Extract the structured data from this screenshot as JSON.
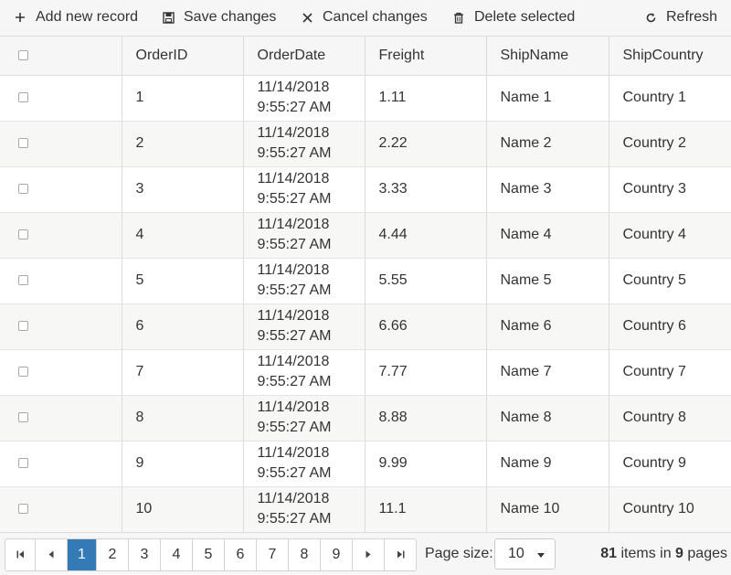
{
  "toolbar": {
    "add_label": "Add new record",
    "save_label": "Save changes",
    "cancel_label": "Cancel changes",
    "delete_label": "Delete selected",
    "refresh_label": "Refresh"
  },
  "grid": {
    "columns": [
      "OrderID",
      "OrderDate",
      "Freight",
      "ShipName",
      "ShipCountry"
    ],
    "rows": [
      {
        "id": "1",
        "date": "11/14/2018",
        "time": "9:55:27 AM",
        "freight": "1.11",
        "name": "Name 1",
        "country": "Country 1"
      },
      {
        "id": "2",
        "date": "11/14/2018",
        "time": "9:55:27 AM",
        "freight": "2.22",
        "name": "Name 2",
        "country": "Country 2"
      },
      {
        "id": "3",
        "date": "11/14/2018",
        "time": "9:55:27 AM",
        "freight": "3.33",
        "name": "Name 3",
        "country": "Country 3"
      },
      {
        "id": "4",
        "date": "11/14/2018",
        "time": "9:55:27 AM",
        "freight": "4.44",
        "name": "Name 4",
        "country": "Country 4"
      },
      {
        "id": "5",
        "date": "11/14/2018",
        "time": "9:55:27 AM",
        "freight": "5.55",
        "name": "Name 5",
        "country": "Country 5"
      },
      {
        "id": "6",
        "date": "11/14/2018",
        "time": "9:55:27 AM",
        "freight": "6.66",
        "name": "Name 6",
        "country": "Country 6"
      },
      {
        "id": "7",
        "date": "11/14/2018",
        "time": "9:55:27 AM",
        "freight": "7.77",
        "name": "Name 7",
        "country": "Country 7"
      },
      {
        "id": "8",
        "date": "11/14/2018",
        "time": "9:55:27 AM",
        "freight": "8.88",
        "name": "Name 8",
        "country": "Country 8"
      },
      {
        "id": "9",
        "date": "11/14/2018",
        "time": "9:55:27 AM",
        "freight": "9.99",
        "name": "Name 9",
        "country": "Country 9"
      },
      {
        "id": "10",
        "date": "11/14/2018",
        "time": "9:55:27 AM",
        "freight": "11.1",
        "name": "Name 10",
        "country": "Country 10"
      }
    ]
  },
  "pager": {
    "pages": [
      "1",
      "2",
      "3",
      "4",
      "5",
      "6",
      "7",
      "8",
      "9"
    ],
    "current_page": "1",
    "page_size_label": "Page size:",
    "page_size": "10",
    "total_items": "81",
    "items_in_text": "items in",
    "total_pages": "9",
    "pages_text": "pages"
  },
  "icons": {
    "add": "plus-icon",
    "save": "floppy-disk-icon",
    "cancel": "close-icon",
    "delete": "trash-icon",
    "refresh": "refresh-icon",
    "first": "first-page-icon",
    "prev": "previous-page-icon",
    "next": "next-page-icon",
    "last": "last-page-icon"
  },
  "colors": {
    "accent": "#337ab7",
    "header_bg": "#f6f6f6",
    "alt_row_bg": "#f7f7f5"
  }
}
